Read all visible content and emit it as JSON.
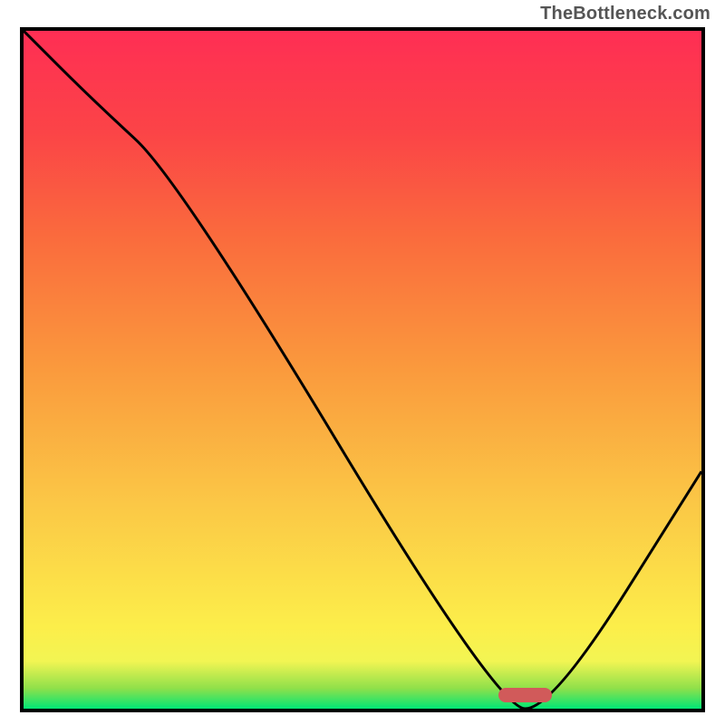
{
  "watermark": "TheBottleneck.com",
  "chart_data": {
    "type": "line",
    "title": "",
    "xlabel": "",
    "ylabel": "",
    "xlim": [
      0,
      100
    ],
    "ylim": [
      0,
      100
    ],
    "grid": false,
    "legend": false,
    "gradient_stops": [
      {
        "pos": 0.0,
        "color": "#00e676"
      },
      {
        "pos": 0.03,
        "color": "#8fe04a"
      },
      {
        "pos": 0.07,
        "color": "#f2f553"
      },
      {
        "pos": 0.12,
        "color": "#fcee4a"
      },
      {
        "pos": 0.3,
        "color": "#fbc846"
      },
      {
        "pos": 0.5,
        "color": "#fa9a3d"
      },
      {
        "pos": 0.7,
        "color": "#fa6a3d"
      },
      {
        "pos": 0.85,
        "color": "#fb4447"
      },
      {
        "pos": 1.0,
        "color": "#ff2e54"
      }
    ],
    "series": [
      {
        "name": "bottleneck-curve",
        "x": [
          0,
          10,
          23,
          70,
          78,
          100
        ],
        "y": [
          100,
          90,
          78,
          0,
          0,
          35
        ]
      }
    ],
    "marker": {
      "name": "optimal-range",
      "x_center": 74,
      "y": 2,
      "width_pct": 8,
      "color": "#d15a5a"
    }
  }
}
